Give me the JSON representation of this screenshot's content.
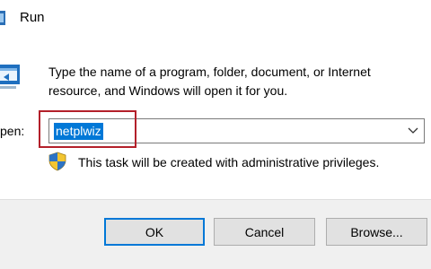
{
  "window": {
    "title": "Run",
    "title_icon": "run-dialog-icon"
  },
  "main": {
    "program_icon": "run-program-icon",
    "description": "Type the name of a program, folder, document, or Internet resource, and Windows will open it for you.",
    "open_label": "pen:",
    "open_value": "netplwiz",
    "dropdown_icon": "chevron-down-icon",
    "admin_icon": "uac-shield-icon",
    "admin_note": "This task will be created with administrative privileges."
  },
  "buttons": {
    "ok": "OK",
    "cancel": "Cancel",
    "browse": "Browse..."
  },
  "colors": {
    "selection": "#0078d7",
    "highlight_box": "#b3202a",
    "button_face": "#e1e1e1",
    "button_bar": "#f0f0f0"
  }
}
